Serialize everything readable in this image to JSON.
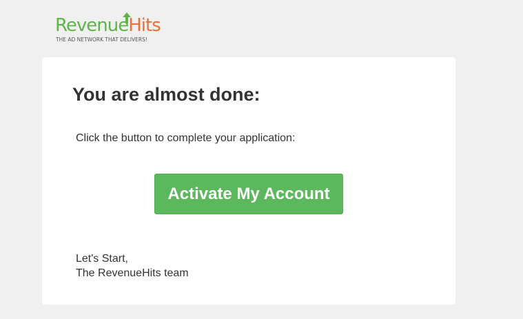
{
  "brand": {
    "name_part1": "Revenue",
    "name_part2": "Hits",
    "tagline": "THE AD NETWORK THAT DELIVERS!",
    "colors": {
      "green": "#5fb44a",
      "orange": "#ef6e32"
    },
    "logo_icon": "up-arrow-icon"
  },
  "email": {
    "heading": "You are almost done:",
    "instruction": "Click the button to complete your application:",
    "button_label": "Activate My Account",
    "signoff_line1": "Let's Start,",
    "signoff_line2": "The RevenueHits team"
  },
  "colors": {
    "page_background": "#f0f0f0",
    "card_background": "#ffffff",
    "button": "#5cb85c",
    "text": "#333333"
  }
}
